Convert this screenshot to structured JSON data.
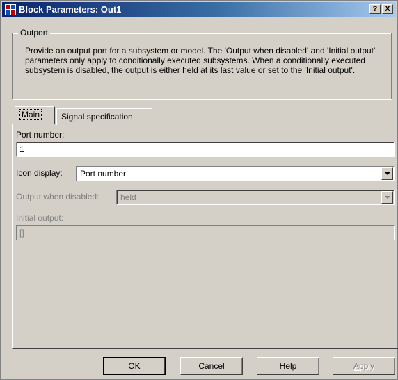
{
  "window": {
    "title": "Block Parameters: Out1",
    "help_label": "?",
    "close_label": "X"
  },
  "group": {
    "label": "Outport",
    "description": "Provide an output port for a subsystem or model.  The 'Output when disabled' and 'Initial output' parameters only apply to conditionally executed subsystems. When a conditionally executed subsystem is disabled, the output is either held at its last value or set to the 'Initial output'."
  },
  "tabs": [
    {
      "label": "Main",
      "selected": true
    },
    {
      "label": "Signal specification",
      "selected": false
    }
  ],
  "fields": {
    "port_number": {
      "label": "Port number:",
      "value": "1"
    },
    "icon_display": {
      "label": "Icon display:",
      "value": "Port number"
    },
    "output_when_disabled": {
      "label": "Output when disabled:",
      "value": "held",
      "enabled": false
    },
    "initial_output": {
      "label": "Initial output:",
      "value": "[]",
      "enabled": false
    }
  },
  "buttons": {
    "ok": {
      "accel": "O",
      "rest": "K"
    },
    "cancel": {
      "accel": "C",
      "rest": "ancel"
    },
    "help": {
      "accel": "H",
      "rest": "elp"
    },
    "apply": {
      "accel": "A",
      "rest": "pply",
      "enabled": false
    }
  },
  "colors": {
    "titlebar_start": "#0a246a",
    "titlebar_end": "#a6caf0",
    "face": "#d4d0c8"
  }
}
